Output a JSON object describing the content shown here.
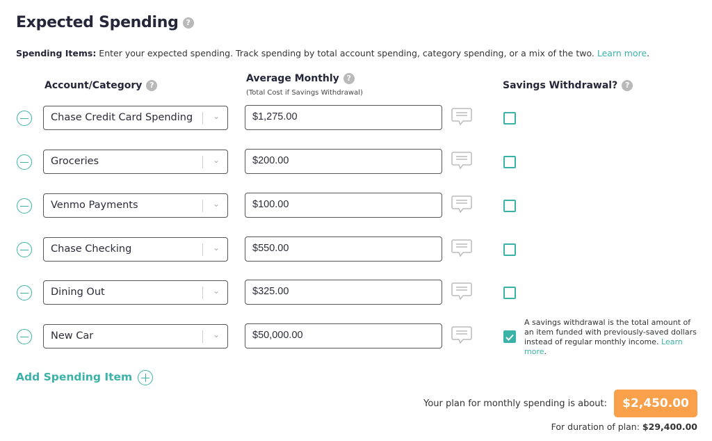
{
  "title": "Expected Spending",
  "intro": {
    "label": "Spending Items:",
    "text": " Enter your expected spending. Track spending by total account spending, category spending, or a mix of the two. ",
    "link": "Learn more",
    "end": "."
  },
  "headers": {
    "account": "Account/Category",
    "average": "Average Monthly",
    "average_sub": "(Total Cost if Savings Withdrawal)",
    "savings": "Savings Withdrawal?",
    "help": "?"
  },
  "items": [
    {
      "category": "Chase Credit Card Spending",
      "amount": "$1,275.00",
      "savings": false
    },
    {
      "category": "Groceries",
      "amount": "$200.00",
      "savings": false
    },
    {
      "category": "Venmo Payments",
      "amount": "$100.00",
      "savings": false
    },
    {
      "category": "Chase Checking",
      "amount": "$550.00",
      "savings": false
    },
    {
      "category": "Dining Out",
      "amount": "$325.00",
      "savings": false
    },
    {
      "category": "New Car",
      "amount": "$50,000.00",
      "savings": true
    }
  ],
  "note": {
    "text": "A savings withdrawal is the total amount of an item funded with previously-saved dollars instead of regular monthly income. ",
    "link": "Learn more",
    "end": "."
  },
  "add_label": "Add Spending Item",
  "summary": {
    "monthly_label": "Your plan for monthly spending is about:",
    "monthly_value": "$2,450.00",
    "duration_label": "For duration of plan: ",
    "duration_value": "$29,400.00"
  },
  "colors": {
    "accent": "#3bb2a8",
    "total": "#f9a04b"
  }
}
